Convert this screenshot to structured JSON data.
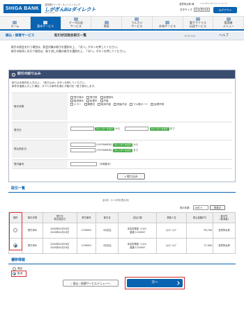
{
  "header": {
    "logo": "SHIGA BANK",
    "brand_sub": "滋賀銀行インターネットバンキング",
    "brand": "しがぎんBizダイレクト",
    "brand_small": "Biz Direct",
    "user": "滋賀商太郎 様",
    "last_login": "20XX年04月16日 10:00:00",
    "font_size_label": "文字サイズ",
    "font_small": "小",
    "font_medium": "中",
    "font_large": "大",
    "logout": "ログアウト"
  },
  "nav": [
    "ホーム",
    "基本サービス",
    "データ伝送\nサービス",
    "承認",
    "でんさい\nサービス",
    "外為サービス",
    "電子ファイル\n伝送サービス",
    "管理者\nメニュー"
  ],
  "breadcrumb": {
    "section": "振込・振替サービス",
    "page": "取引状況照会取引一覧",
    "screen_id": "BTZF009",
    "help": "ヘルプ"
  },
  "intro": [
    "取引の照会を行う場合は、照会対象の取引を選択の上、「次へ」ボタンを押してください。",
    "取引の取消しを行う場合は、取り消し対象の取引を選択の上、「次へ」ボタンを押してください。"
  ],
  "search": {
    "title": "取引の絞り込み",
    "desc": [
      "絞り込み条件を入力の上、「絞り込み」ボタンを押してください。",
      "条件を複数入力した場合、すべての条件を満たす取引を一覧で表示します。"
    ],
    "labels": {
      "status": "取引状態",
      "date": "受付日",
      "transfer_date": "振込指定日",
      "receipt_no": "受付番号"
    },
    "status_opts": [
      "受付済み",
      "受付前",
      "処理済み",
      "取消済み",
      "処理中",
      "不能",
      "エラー",
      "期限切",
      "取消不能",
      "残高不足",
      "マル規オーバ",
      "処理不明"
    ],
    "calendar": "カレンダーを表示",
    "from": "から",
    "to": "まで",
    "date_fmt": "(YYYYMMDD)",
    "half_width": "（半角数字）",
    "button": "絞り込み"
  },
  "results": {
    "title": "取引一覧",
    "count": "全2件（1〜2件を表示中）",
    "display_label": "表示件数：",
    "display_value": "10件",
    "redisplay": "再表示",
    "headers": [
      "選択",
      "取引状態",
      "受付日\n振込指定日",
      "受付番号",
      "取引名",
      "支払口座",
      "受取人名",
      "振込金額(円)",
      "取引先\n(取消者)"
    ],
    "rows": [
      {
        "status": "受付済み",
        "date": "20XX年04月18日\n20XX年04月18日",
        "no": "1190002",
        "name": "4月支払",
        "account": "本店営業部（110）\n普通 1234567",
        "payee": "ｶ)ｼｶﾞｼｮｳｼﾞ",
        "amount": "89,700",
        "operator": "滋賀商太郎"
      },
      {
        "status": "受付済み",
        "date": "20XX年04月18日\n20XX年04月18日",
        "no": "1190001",
        "name": "4月支払",
        "account": "本店営業部（110）\n普通 1234567",
        "payee": "ｶ)ｼｶﾞｼｮｳｼﾞ",
        "amount": "27,000",
        "operator": "滋賀商太郎"
      }
    ]
  },
  "next_op": {
    "title": "遷移情報",
    "opt1": "照会",
    "opt2": "取消"
  },
  "footer": {
    "back": "振込・振替サービスメニューへ",
    "next": "次へ"
  }
}
